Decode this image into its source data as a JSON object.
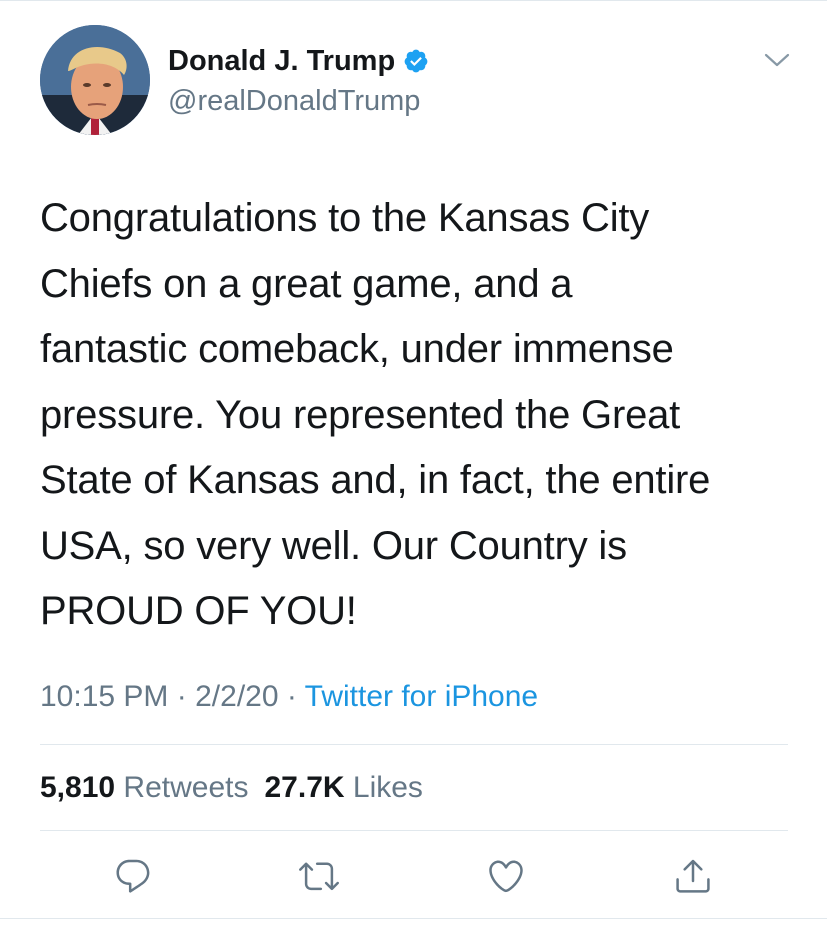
{
  "author": {
    "display_name": "Donald J. Trump",
    "handle": "@realDonaldTrump",
    "verified": true,
    "avatar_icon": "profile-photo"
  },
  "tweet": {
    "lines": [
      "Congratulations to the Kansas City",
      "Chiefs on a great game, and a",
      "fantastic comeback, under immense",
      "pressure. You represented the Great",
      "State of Kansas and, in fact, the entire",
      "USA, so very well. Our Country is",
      "PROUD OF YOU!"
    ],
    "time": "10:15 PM",
    "date": "2/2/20",
    "separator": "·",
    "source": "Twitter for iPhone"
  },
  "stats": {
    "retweets_count": "5,810",
    "retweets_label": "Retweets",
    "likes_count": "27.7K",
    "likes_label": "Likes"
  },
  "actions": [
    {
      "name": "reply",
      "icon": "speech-bubble-icon"
    },
    {
      "name": "retweet",
      "icon": "retweet-arrows-icon"
    },
    {
      "name": "like",
      "icon": "heart-icon"
    },
    {
      "name": "share",
      "icon": "share-upload-icon"
    }
  ],
  "colors": {
    "text": "#14171a",
    "secondary": "#657786",
    "link": "#1b95e0",
    "verified": "#1da1f2",
    "divider": "#e1e8ed"
  }
}
